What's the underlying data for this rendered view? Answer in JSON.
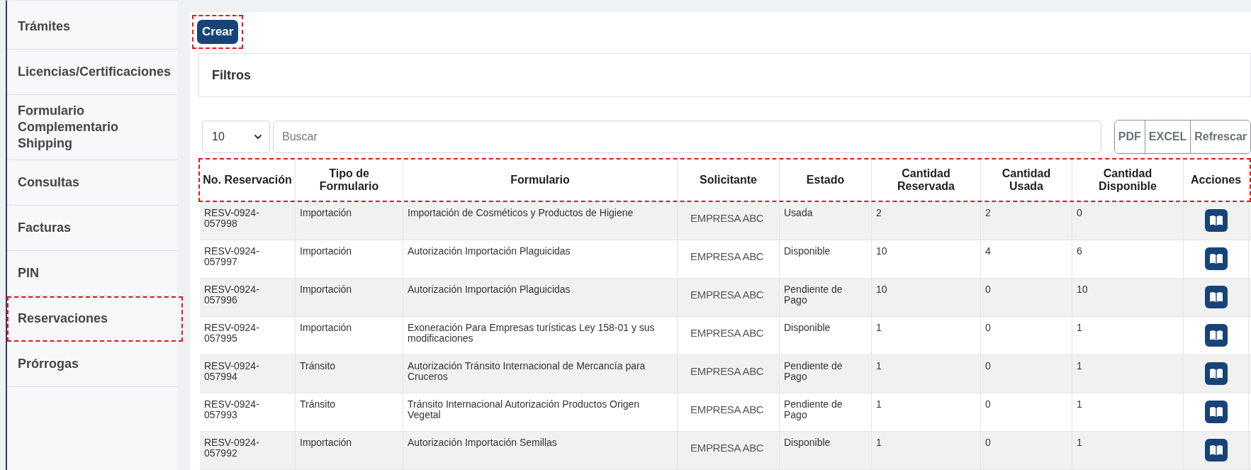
{
  "sidebar": {
    "items": [
      {
        "label": "Trámites",
        "highlighted": false
      },
      {
        "label": "Licencias/Certificaciones",
        "highlighted": false
      },
      {
        "label": "Formulario Complementario Shipping",
        "highlighted": false
      },
      {
        "label": "Consultas",
        "highlighted": false
      },
      {
        "label": "Facturas",
        "highlighted": false
      },
      {
        "label": "PIN",
        "highlighted": false
      },
      {
        "label": "Reservaciones",
        "highlighted": true
      },
      {
        "label": "Prórrogas",
        "highlighted": false
      }
    ]
  },
  "create_button": {
    "label": "Crear",
    "highlighted": true
  },
  "filters": {
    "title": "Filtros"
  },
  "toolbar": {
    "page_size": "10",
    "search": {
      "placeholder": "Buscar"
    },
    "buttons": [
      "PDF",
      "EXCEL",
      "Refrescar"
    ]
  },
  "table": {
    "header_highlighted": true,
    "columns": [
      "No. Reservación",
      "Tipo de Formulario",
      "Formulario",
      "Solicitante",
      "Estado",
      "Cantidad Reservada",
      "Cantidad Usada",
      "Cantidad Disponible",
      "Acciones"
    ],
    "rows": [
      {
        "reservation": "RESV-0924-057998",
        "type": "Importación",
        "form": "Importación de Cosméticos y Productos de Higiene",
        "applicant": "EMPRESA ABC",
        "status": "Usada",
        "reserved": "2",
        "used": "2",
        "available": "0"
      },
      {
        "reservation": "RESV-0924-057997",
        "type": "Importación",
        "form": "Autorización Importación Plaguicidas",
        "applicant": "EMPRESA ABC",
        "status": "Disponible",
        "reserved": "10",
        "used": "4",
        "available": "6"
      },
      {
        "reservation": "RESV-0924-057996",
        "type": "Importación",
        "form": "Autorización Importación Plaguicidas",
        "applicant": "EMPRESA ABC",
        "status": "Pendiente de Pago",
        "reserved": "10",
        "used": "0",
        "available": "10"
      },
      {
        "reservation": "RESV-0924-057995",
        "type": "Importación",
        "form": "Exoneración Para Empresas turísticas Ley 158-01 y sus modificaciones",
        "applicant": "EMPRESA ABC",
        "status": "Disponible",
        "reserved": "1",
        "used": "0",
        "available": "1"
      },
      {
        "reservation": "RESV-0924-057994",
        "type": "Tránsito",
        "form": "Autorización Tránsito Internacional de Mercancía para Cruceros",
        "applicant": "EMPRESA ABC",
        "status": "Pendiente de Pago",
        "reserved": "1",
        "used": "0",
        "available": "1"
      },
      {
        "reservation": "RESV-0924-057993",
        "type": "Tránsito",
        "form": "Tránsito Internacional Autorización Productos Origen Vegetal",
        "applicant": "EMPRESA ABC",
        "status": "Pendiente de Pago",
        "reserved": "1",
        "used": "0",
        "available": "1"
      },
      {
        "reservation": "RESV-0924-057992",
        "type": "Importación",
        "form": "Autorización Importación Semillas",
        "applicant": "EMPRESA ABC",
        "status": "Disponible",
        "reserved": "1",
        "used": "0",
        "available": "1"
      }
    ]
  }
}
